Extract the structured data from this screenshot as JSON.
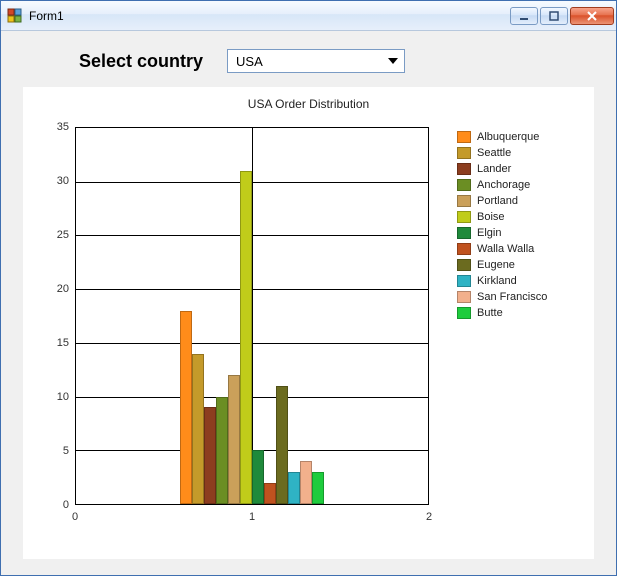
{
  "window": {
    "title": "Form1"
  },
  "controls": {
    "label": "Select country",
    "combo_value": "USA"
  },
  "chart_data": {
    "type": "bar",
    "title": "USA Order Distribution",
    "xlabel": "",
    "ylabel": "",
    "xlim": [
      0,
      2
    ],
    "ylim": [
      0,
      35
    ],
    "y_ticks": [
      0,
      5,
      10,
      15,
      20,
      25,
      30,
      35
    ],
    "x_ticks": [
      0,
      1,
      2
    ],
    "categories": [
      "1"
    ],
    "series": [
      {
        "name": "Albuquerque",
        "color": "#ff8c1a",
        "values": [
          18
        ]
      },
      {
        "name": "Seattle",
        "color": "#c49a2a",
        "values": [
          14
        ]
      },
      {
        "name": "Lander",
        "color": "#8c3d1f",
        "values": [
          9
        ]
      },
      {
        "name": "Anchorage",
        "color": "#6b8e23",
        "values": [
          10
        ]
      },
      {
        "name": "Portland",
        "color": "#caa05a",
        "values": [
          12
        ]
      },
      {
        "name": "Boise",
        "color": "#c0cc1a",
        "values": [
          31
        ]
      },
      {
        "name": "Elgin",
        "color": "#1f8a3b",
        "values": [
          5
        ]
      },
      {
        "name": "Walla Walla",
        "color": "#c0521f",
        "values": [
          2
        ]
      },
      {
        "name": "Eugene",
        "color": "#6b6b1f",
        "values": [
          11
        ]
      },
      {
        "name": "Kirkland",
        "color": "#2fb3c4",
        "values": [
          3
        ]
      },
      {
        "name": "San Francisco",
        "color": "#f2b08c",
        "values": [
          4
        ]
      },
      {
        "name": "Butte",
        "color": "#1ecc3d",
        "values": [
          3
        ]
      }
    ]
  }
}
